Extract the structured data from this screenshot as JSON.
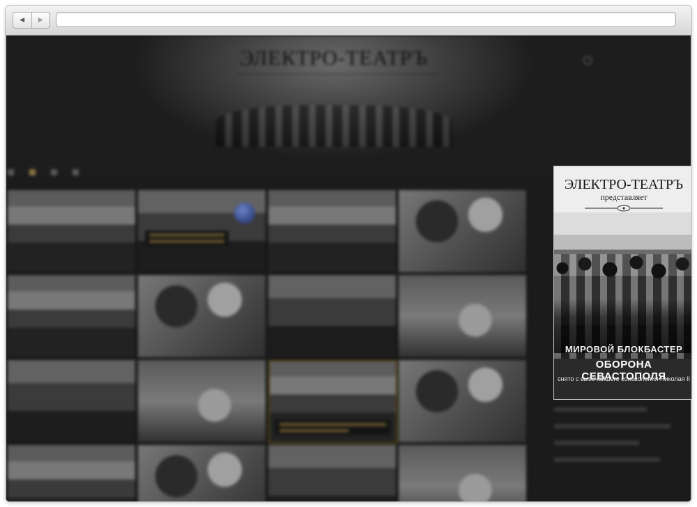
{
  "browser": {
    "back_label": "◀",
    "forward_label": "▶",
    "url": ""
  },
  "site": {
    "logo": "ЭЛЕКТРО-ТЕАТРЪ",
    "tagline": "",
    "login": "",
    "section_title": "",
    "filters": [
      "",
      "",
      "",
      ""
    ],
    "tiles": [
      "",
      "",
      "",
      "",
      "",
      "",
      "",
      "",
      "",
      "",
      "",
      "",
      "",
      "",
      "",
      ""
    ]
  },
  "poster": {
    "title": "ЭЛЕКТРО-ТЕАТРЪ",
    "subtitle": "представляет",
    "tagline": "МИРОВОЙ БЛОКБАСТЕР",
    "film": "ОБОРОНА СЕВАСТОПОЛЯ",
    "note": "снято с высочайшего соизволения Николая II"
  },
  "colors": {
    "page_bg": "#1b1b1b",
    "highlight_border": "#5a4515",
    "poster_bg": "#eeeeee"
  }
}
